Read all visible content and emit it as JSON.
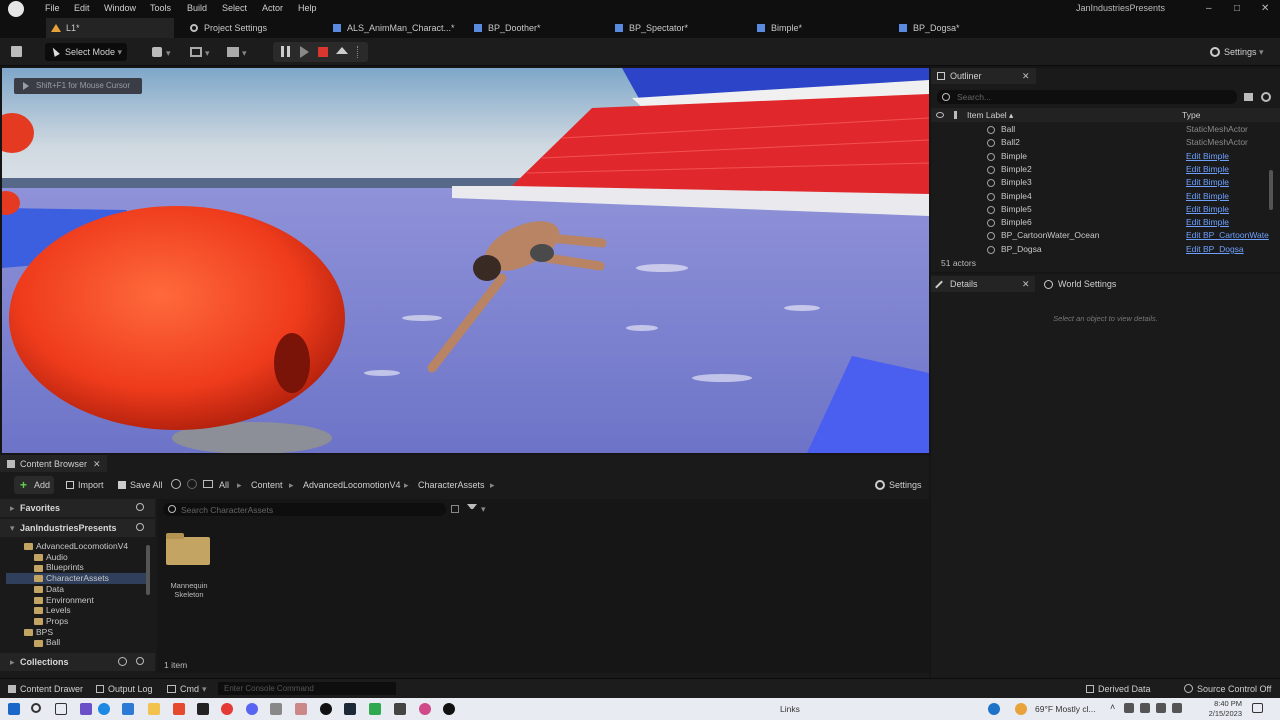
{
  "menu": [
    "File",
    "Edit",
    "Window",
    "Tools",
    "Build",
    "Select",
    "Actor",
    "Help"
  ],
  "project_name": "JanIndustriesPresents",
  "tabs": [
    {
      "label": "L1*"
    },
    {
      "label": "Project Settings"
    },
    {
      "label": "ALS_AnimMan_Charact...*"
    },
    {
      "label": "BP_Doother*"
    },
    {
      "label": "BP_Spectator*"
    },
    {
      "label": "Bimple*"
    },
    {
      "label": "BP_Dogsa*"
    }
  ],
  "toolbar": {
    "select_mode": "Select Mode",
    "settings": "Settings"
  },
  "viewport": {
    "hint": "Shift+F1 for Mouse Cursor"
  },
  "outliner": {
    "title": "Outliner",
    "search_placeholder": "Search...",
    "col_label": "Item Label ▴",
    "col_type": "Type",
    "rows": [
      {
        "name": "Ball",
        "type": "StaticMeshActor",
        "link": false
      },
      {
        "name": "Ball2",
        "type": "StaticMeshActor",
        "link": false
      },
      {
        "name": "Bimple",
        "type": "Edit Bimple",
        "link": true
      },
      {
        "name": "Bimple2",
        "type": "Edit Bimple",
        "link": true
      },
      {
        "name": "Bimple3",
        "type": "Edit Bimple",
        "link": true
      },
      {
        "name": "Bimple4",
        "type": "Edit Bimple",
        "link": true
      },
      {
        "name": "Bimple5",
        "type": "Edit Bimple",
        "link": true
      },
      {
        "name": "Bimple6",
        "type": "Edit Bimple",
        "link": true
      },
      {
        "name": "BP_CartoonWater_Ocean",
        "type": "Edit BP_CartoonWate",
        "link": true
      },
      {
        "name": "BP_Dogsa",
        "type": "Edit BP_Dogsa",
        "link": true
      }
    ],
    "actor_count": "51 actors"
  },
  "details": {
    "tab_details": "Details",
    "tab_world": "World Settings",
    "empty_msg": "Select an object to view details."
  },
  "content_browser": {
    "title": "Content Browser",
    "add": "Add",
    "import": "Import",
    "save_all": "Save All",
    "breadcrumb": [
      "All",
      "Content",
      "AdvancedLocomotionV4",
      "CharacterAssets"
    ],
    "settings": "Settings",
    "favorites": "Favorites",
    "project": "JanIndustriesPresents",
    "search_placeholder": "Search CharacterAssets",
    "tree": [
      "AdvancedLocomotionV4",
      "Audio",
      "Blueprints",
      "CharacterAssets",
      "Data",
      "Environment",
      "Levels",
      "Props",
      "BPS",
      "Ball"
    ],
    "collections": "Collections",
    "asset": {
      "line1": "Mannequin",
      "line2": "Skeleton"
    },
    "item_count": "1 item"
  },
  "statusbar": {
    "content_drawer": "Content Drawer",
    "output_log": "Output Log",
    "cmd": "Cmd",
    "console_placeholder": "Enter Console Command",
    "derived_data": "Derived Data",
    "source_control": "Source Control Off"
  },
  "taskbar": {
    "links": "Links",
    "weather": "69°F  Mostly cl...",
    "time": "8:40 PM",
    "date": "2/15/2023"
  },
  "colors": {
    "accent": "#4a78c2",
    "link": "#6ea1ff",
    "stop_red": "#d8362e"
  }
}
